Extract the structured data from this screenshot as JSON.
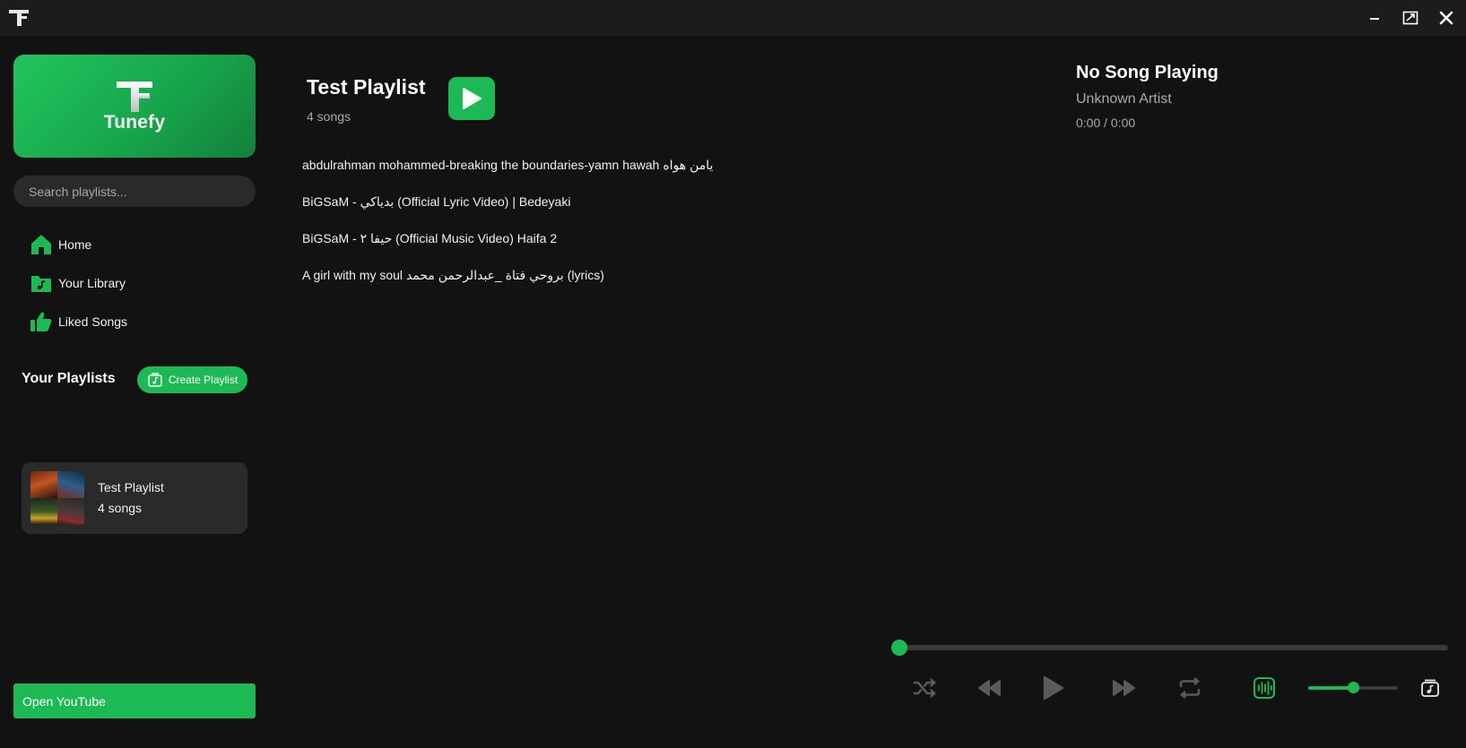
{
  "app": {
    "brand_name": "Tunefy",
    "accent_color": "#1db954"
  },
  "window_controls": [
    "minimize-icon",
    "maximize-icon",
    "close-icon"
  ],
  "sidebar": {
    "search_placeholder": "Search playlists...",
    "nav": [
      {
        "label": "Home",
        "icon": "home-icon"
      },
      {
        "label": "Your Library",
        "icon": "library-icon"
      },
      {
        "label": "Liked Songs",
        "icon": "thumbs-up-icon"
      }
    ],
    "playlists_heading": "Your Playlists",
    "create_playlist_label": "Create Playlist",
    "playlists": [
      {
        "title": "Test Playlist",
        "count": "4 songs"
      }
    ],
    "open_youtube_label": "Open YouTube"
  },
  "main": {
    "title": "Test Playlist",
    "count": "4 songs",
    "songs": [
      "abdulrahman mohammed-breaking the boundaries-yamn hawah يامن هواه",
      "BiGSaM - بدياكي (Official Lyric Video)  |  Bedeyaki",
      "BiGSaM - حيفا ٢ (Official Music Video) Haifa 2",
      "A girl with my soul بروحي فتاة _عبدالرحمن محمد (lyrics)"
    ]
  },
  "now_playing": {
    "title": "No Song Playing",
    "artist": "Unknown Artist",
    "time": "0:00 / 0:00"
  },
  "player": {
    "progress": 0,
    "volume": 0.5,
    "controls": [
      "shuffle-icon",
      "previous-icon",
      "play-icon",
      "next-icon",
      "repeat-icon",
      "visualizer-icon",
      "queue-icon"
    ]
  }
}
